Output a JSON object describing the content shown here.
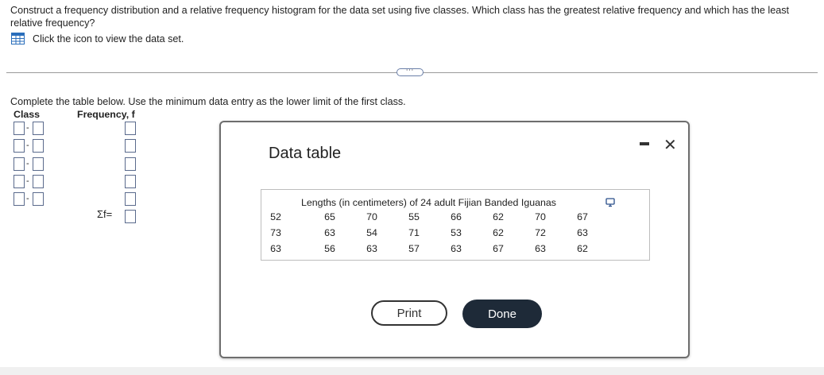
{
  "question": {
    "text": "Construct a frequency distribution and a relative frequency histogram for the data set using five classes. Which class has the greatest relative frequency and which has the least relative frequency?",
    "dataset_link": "Click the icon to view the data set."
  },
  "instruction": "Complete the table below. Use the minimum data entry as the lower limit of the first class.",
  "table": {
    "class_header": "Class",
    "frequency_header": "Frequency, f",
    "class_separator": "-",
    "sum_label": "Σf="
  },
  "modal": {
    "title": "Data table",
    "caption": "Lengths (in centimeters) of 24 adult Fijian Banded Iguanas",
    "rows": [
      [
        "52",
        "65",
        "70",
        "55",
        "66",
        "62",
        "70",
        "67"
      ],
      [
        "73",
        "63",
        "54",
        "71",
        "53",
        "62",
        "72",
        "63"
      ],
      [
        "63",
        "56",
        "63",
        "57",
        "63",
        "67",
        "63",
        "62"
      ]
    ],
    "print_label": "Print",
    "done_label": "Done"
  },
  "more_label": "⋯",
  "icons": [
    "grid-table-icon",
    "minimize-icon",
    "close-icon",
    "copy-icon"
  ]
}
